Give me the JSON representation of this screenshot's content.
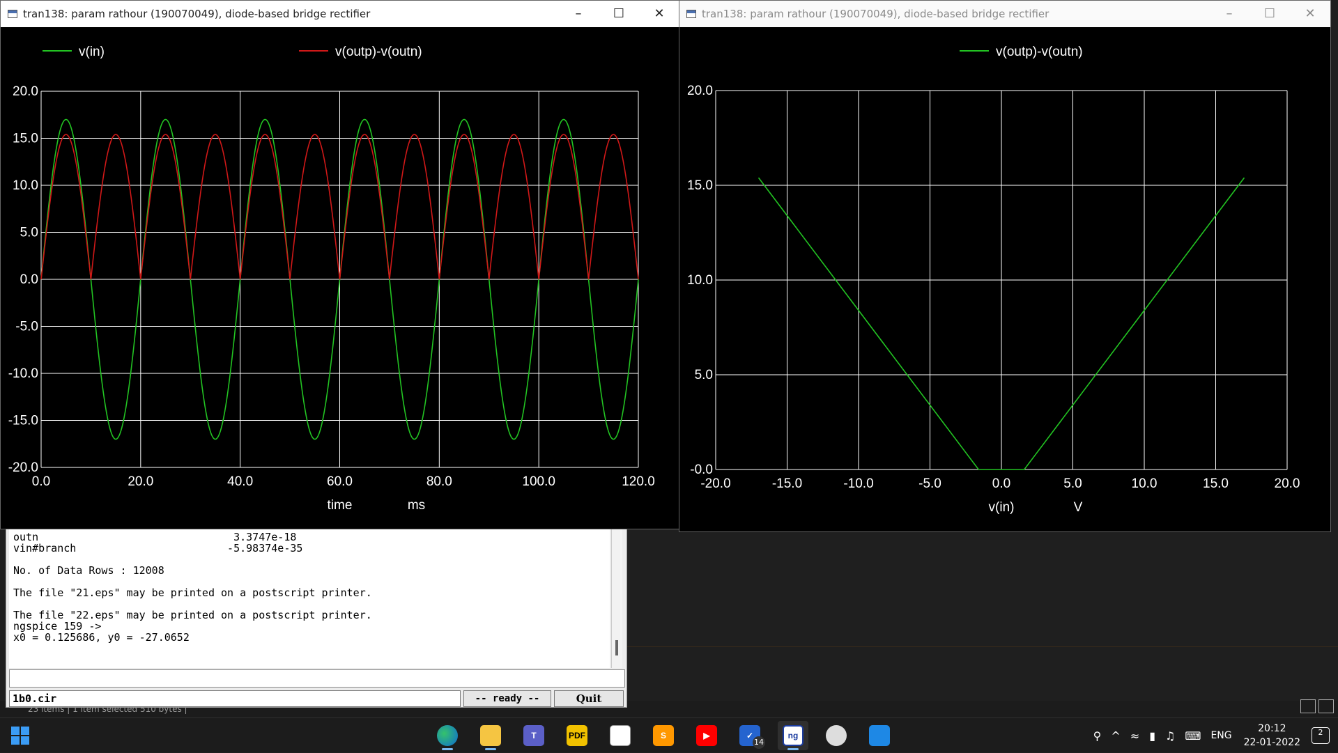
{
  "colors": {
    "green": "#22c322",
    "red": "#d01818",
    "grid": "#ffffff",
    "bg": "#000000"
  },
  "window1": {
    "title": "tran138: param rathour (190070049), diode-based bridge rectifier",
    "legend": [
      "v(in)",
      "v(outp)-v(outn)"
    ],
    "xlabel": "time",
    "xunit": "ms"
  },
  "window2": {
    "title": "tran138: param rathour (190070049), diode-based bridge rectifier",
    "legend": [
      "v(outp)-v(outn)"
    ],
    "xlabel": "v(in)",
    "xunit": "V"
  },
  "chart_data": [
    {
      "type": "line",
      "xlabel": "time",
      "xunit": "ms",
      "xlim": [
        0,
        120
      ],
      "ylim": [
        -20,
        20
      ],
      "xticks": [
        "0.0",
        "20.0",
        "40.0",
        "60.0",
        "80.0",
        "100.0",
        "120.0"
      ],
      "yticks": [
        "20.0",
        "15.0",
        "10.0",
        "5.0",
        "0.0",
        "-5.0",
        "-10.0",
        "-15.0",
        "-20.0"
      ],
      "grid": true,
      "legend": "top",
      "series": [
        {
          "name": "v(in)",
          "function": "sine",
          "amplitude": 17,
          "period_ms": 20,
          "color": "#22c322"
        },
        {
          "name": "v(outp)-v(outn)",
          "function": "full-wave rectified sine",
          "amplitude": 15.4,
          "period_ms": 20,
          "color": "#d01818"
        }
      ]
    },
    {
      "type": "line",
      "xlabel": "v(in)",
      "xunit": "V",
      "xlim": [
        -20,
        20
      ],
      "ylim": [
        0,
        20
      ],
      "xticks": [
        "-20.0",
        "-15.0",
        "-10.0",
        "-5.0",
        "0.0",
        "5.0",
        "10.0",
        "15.0",
        "20.0"
      ],
      "yticks": [
        "20.0",
        "15.0",
        "10.0",
        "5.0",
        "-0.0"
      ],
      "grid": true,
      "legend": "top",
      "series": [
        {
          "name": "v(outp)-v(outn)",
          "x": [
            -17,
            -1.6,
            -0.6,
            0.6,
            1.6,
            17
          ],
          "y": [
            15.4,
            0,
            0,
            0,
            0,
            15.4
          ],
          "color": "#22c322"
        }
      ]
    }
  ],
  "console": {
    "lines": [
      "outn                               3.3747e-18",
      "vin#branch                        -5.98374e-35",
      "",
      "No. of Data Rows : 12008",
      "",
      "The file \"21.eps\" may be printed on a postscript printer.",
      "",
      "The file \"22.eps\" may be printed on a postscript printer.",
      "ngspice 159 ->",
      "x0 = 0.125686, y0 = -27.0652"
    ],
    "file": "1b0.cir",
    "status": "-- ready --",
    "quit": "Quit"
  },
  "taskbar": {
    "apps": [
      "edge",
      "file-explorer",
      "teams",
      "pdf",
      "paint",
      "sublime",
      "youtube",
      "todo",
      "ngspice",
      "media",
      "photos"
    ],
    "todo_badge": "14",
    "lang": "ENG",
    "time": "20:12",
    "date": "22-01-2022",
    "notifications": "2"
  },
  "explorer_status": "23 items  |  1 item selected  510 bytes  |"
}
